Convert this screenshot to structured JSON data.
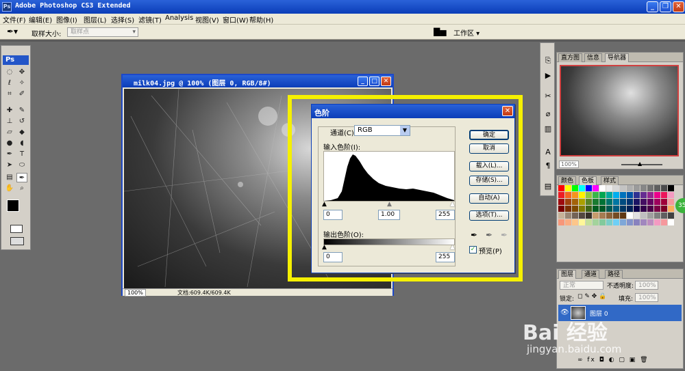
{
  "app": {
    "title": "Adobe Photoshop CS3 Extended",
    "icon_text": "Ps"
  },
  "window_buttons": {
    "minimize": "_",
    "restore": "❐",
    "close": "✕"
  },
  "menu": [
    "文件(F)",
    "编辑(E)",
    "图像(I)",
    "图层(L)",
    "选择(S)",
    "滤镜(T)",
    "Analysis",
    "视图(V)",
    "窗口(W)",
    "帮助(H)"
  ],
  "options_bar": {
    "sample_size_label": "取样大小:",
    "sample_size_value": "取样点",
    "workspace_label": "工作区"
  },
  "tools_logo": "Ps",
  "document": {
    "title": "milk04.jpg @ 100% (图层 0, RGB/8#)",
    "zoom": "100%",
    "status": "文档:609.4K/609.4K"
  },
  "levels": {
    "title": "色阶",
    "channel_label": "通道(C):",
    "channel_value": "RGB",
    "input_label": "输入色阶(I):",
    "input_black": "0",
    "input_gamma": "1.00",
    "input_white": "255",
    "output_label": "输出色阶(O):",
    "output_black": "0",
    "output_white": "255",
    "buttons": {
      "ok": "确定",
      "cancel": "取消",
      "load": "载入(L)...",
      "save": "存储(S)...",
      "auto": "自动(A)",
      "options": "选项(T)..."
    },
    "preview_label": "预览(P)",
    "preview_checked": true
  },
  "navigator": {
    "tabs": [
      "直方图",
      "信息",
      "导航器"
    ],
    "zoom": "100%"
  },
  "color_panel": {
    "tabs": [
      "颜色",
      "色板",
      "样式"
    ]
  },
  "layers_panel": {
    "tabs": [
      "图层",
      "通道",
      "路径"
    ],
    "blend_mode": "正常",
    "opacity_label": "不透明度:",
    "opacity_value": "100%",
    "lock_label": "锁定:",
    "fill_label": "填充:",
    "fill_value": "100%",
    "layer_name": "图层 0",
    "bottom_icons": "∞ fx ◘ ◐ ▢ ▣ 🗑"
  },
  "watermark": {
    "brand": "Bai  经验",
    "url": "jingyan.baidu.com"
  },
  "badge": "35"
}
